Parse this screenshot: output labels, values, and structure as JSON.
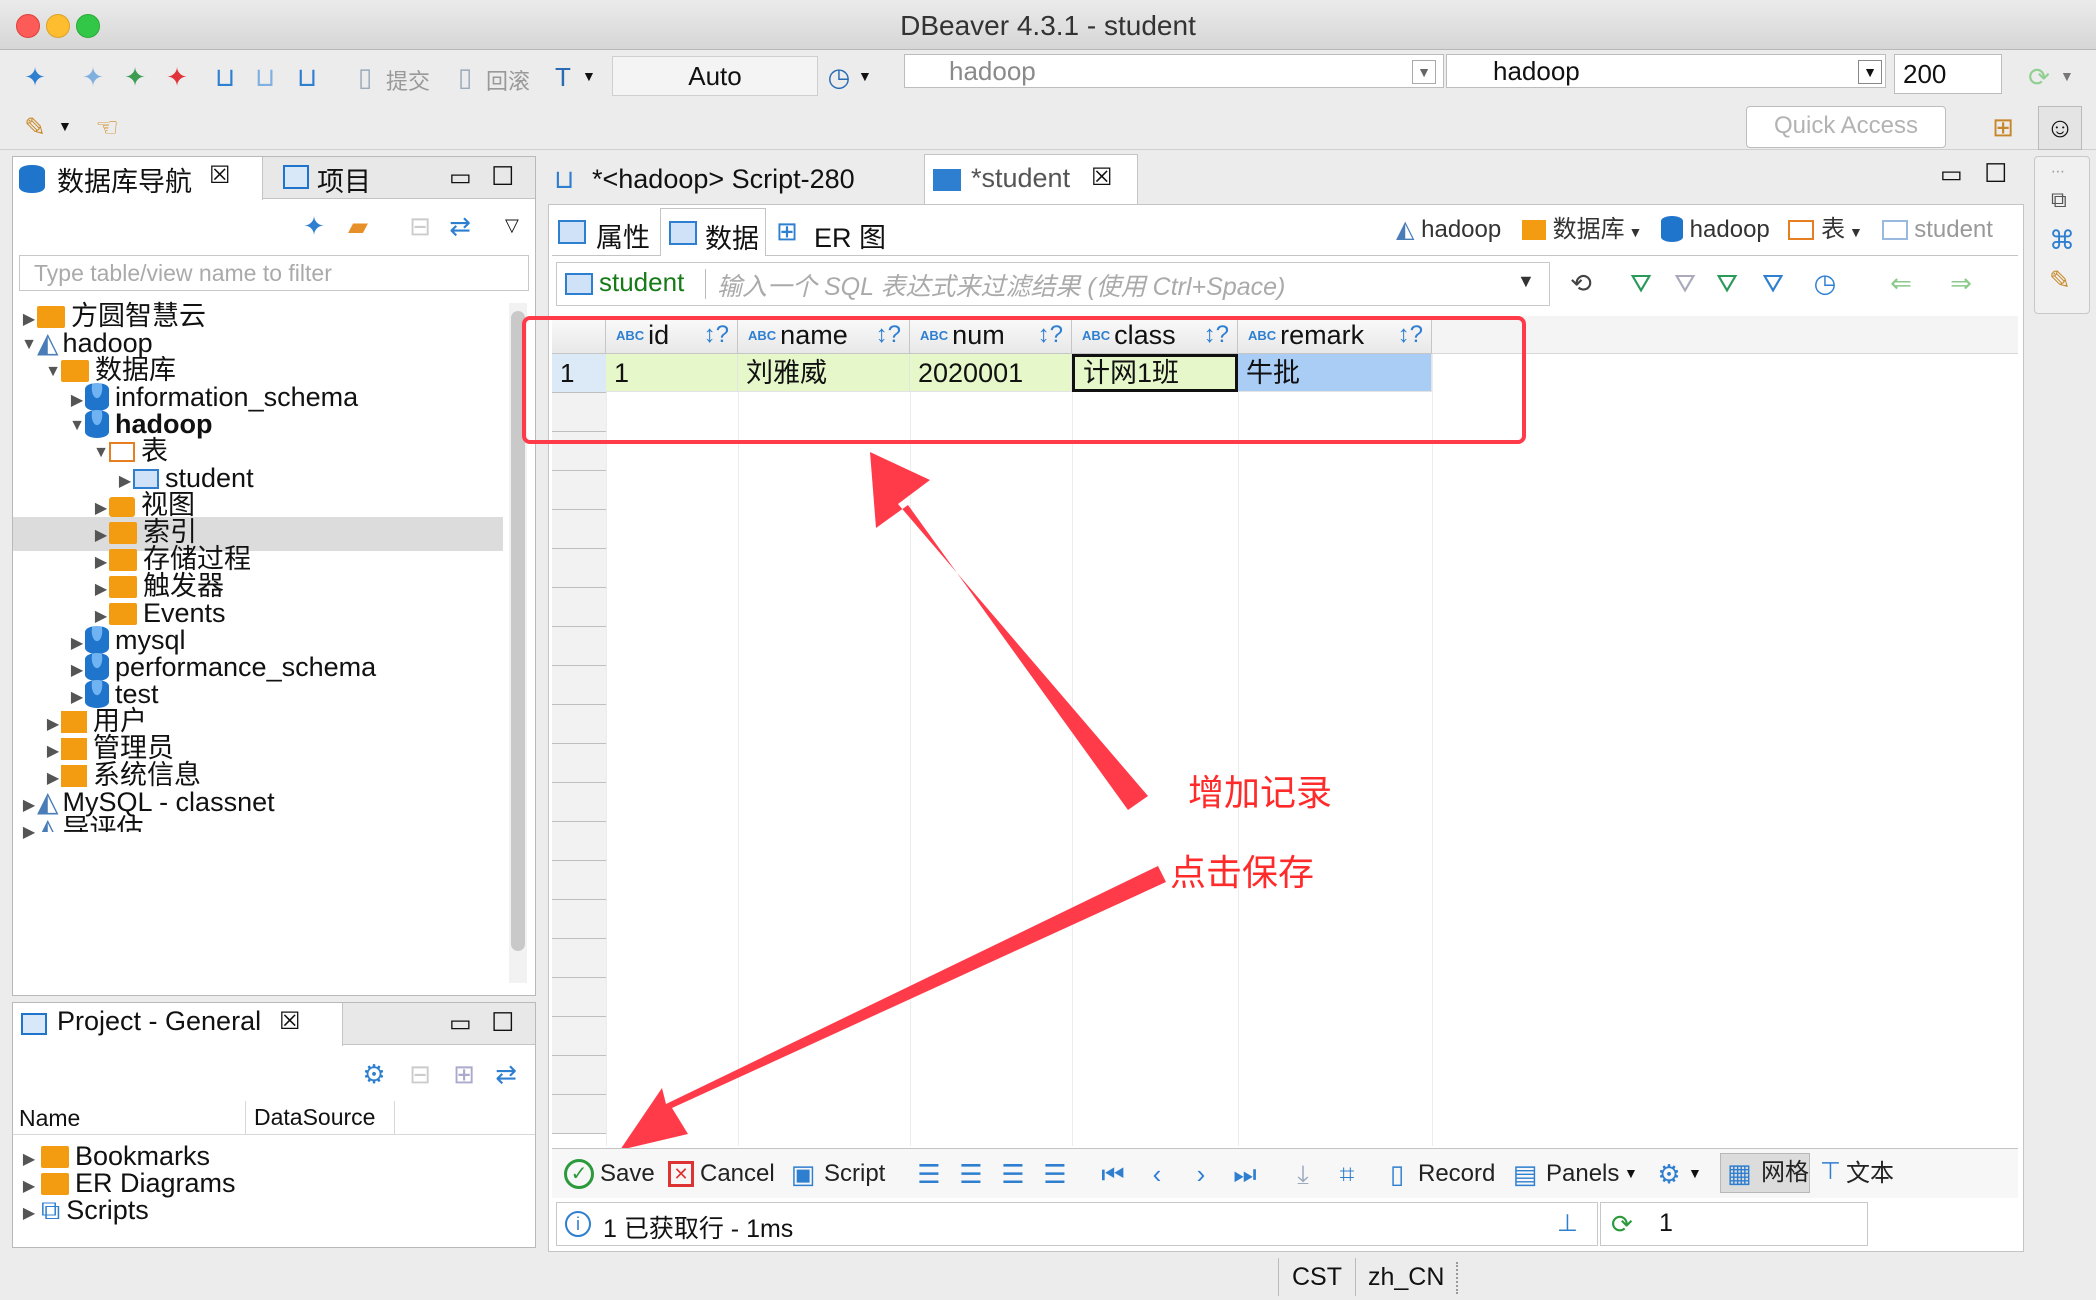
{
  "window": {
    "title": "DBeaver 4.3.1 - student"
  },
  "toolbar": {
    "commit_label": "提交",
    "rollback_label": "回滚",
    "mode_value": "Auto",
    "datasource_value": "hadoop",
    "schema_value": "hadoop",
    "fetch_size": "200",
    "quick_access_placeholder": "Quick Access"
  },
  "navigator": {
    "tab_label": "数据库导航",
    "projects_tab_label": "项目",
    "filter_placeholder": "Type table/view name to filter",
    "items": [
      {
        "label": "方圆智慧云"
      },
      {
        "label": "hadoop"
      },
      {
        "label": "数据库"
      },
      {
        "label": "information_schema"
      },
      {
        "label": "hadoop"
      },
      {
        "label": "表"
      },
      {
        "label": "student"
      },
      {
        "label": "视图"
      },
      {
        "label": "索引"
      },
      {
        "label": "存储过程"
      },
      {
        "label": "触发器"
      },
      {
        "label": "Events"
      },
      {
        "label": "mysql"
      },
      {
        "label": "performance_schema"
      },
      {
        "label": "test"
      },
      {
        "label": "用户"
      },
      {
        "label": "管理员"
      },
      {
        "label": "系统信息"
      },
      {
        "label": "MySQL - classnet"
      },
      {
        "label": "导评估"
      }
    ]
  },
  "project": {
    "tab_label": "Project - General",
    "col_name": "Name",
    "col_datasource": "DataSource",
    "items": [
      {
        "label": "Bookmarks"
      },
      {
        "label": "ER Diagrams"
      },
      {
        "label": "Scripts"
      }
    ]
  },
  "editor": {
    "tabs": [
      {
        "label": "*<hadoop> Script-280"
      },
      {
        "label": "*student"
      }
    ],
    "subtabs": [
      {
        "label": "属性"
      },
      {
        "label": "数据"
      },
      {
        "label": "ER 图"
      }
    ],
    "breadcrumb": {
      "ds": "hadoop",
      "db_label": "数据库",
      "db": "hadoop",
      "tables_label": "表",
      "table": "student"
    },
    "filter_table": "student",
    "filter_placeholder": "输入一个 SQL 表达式来过滤结果 (使用 Ctrl+Space)",
    "columns": [
      {
        "type": "ABC",
        "label": "id"
      },
      {
        "type": "ABC",
        "label": "name"
      },
      {
        "type": "ABC",
        "label": "num"
      },
      {
        "type": "ABC",
        "label": "class"
      },
      {
        "type": "ABC",
        "label": "remark"
      }
    ],
    "rows": [
      {
        "num": "1",
        "cells": [
          "1",
          "刘雅威",
          "2020001",
          "计网1班",
          "牛批"
        ]
      }
    ]
  },
  "bottom_toolbar": {
    "save": "Save",
    "cancel": "Cancel",
    "script": "Script",
    "record": "Record",
    "panels": "Panels",
    "grid": "网格",
    "text": "文本"
  },
  "status": {
    "message": "1 已获取行 - 1ms",
    "count": "1",
    "timezone": "CST",
    "locale": "zh_CN"
  },
  "annotations": {
    "add_record": "增加记录",
    "click_save": "点击保存"
  },
  "colors": {
    "accent": "#2f7fd0",
    "annotation": "#ff3b3b",
    "folder": "#f39c12",
    "new_row": "#e6f8c9",
    "selected_cell": "#a9cdf5"
  }
}
